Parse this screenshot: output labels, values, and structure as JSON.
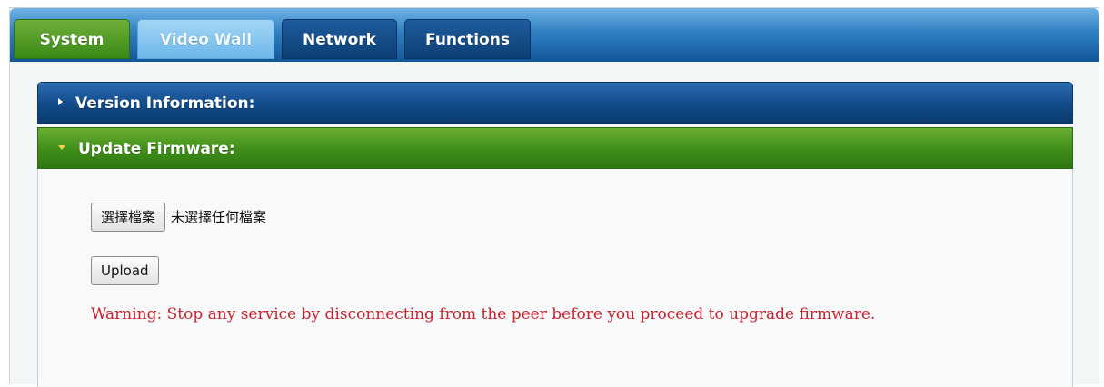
{
  "tabs": [
    {
      "label": "System",
      "state": "active"
    },
    {
      "label": "Video Wall",
      "state": "highlighted"
    },
    {
      "label": "Network",
      "state": "inactive"
    },
    {
      "label": "Functions",
      "state": "inactive"
    }
  ],
  "panels": {
    "version": {
      "title": "Version Information:",
      "expanded": false
    },
    "firmware": {
      "title": "Update Firmware:",
      "expanded": true
    }
  },
  "firmware": {
    "choose_file_label": "選擇檔案",
    "file_status": "未選擇任何檔案",
    "upload_label": "Upload",
    "warning": "Warning: Stop any service by disconnecting from the peer before you proceed to upgrade firmware."
  },
  "icons": {
    "version_toggle": "caret-right-icon",
    "firmware_toggle": "caret-down-icon"
  },
  "colors": {
    "tabbar_blue": "#2f7fc1",
    "active_green": "#3f8d19",
    "header_navy": "#124b8a",
    "warning_red": "#c8232c",
    "caret_yellow": "#f2d34b"
  }
}
